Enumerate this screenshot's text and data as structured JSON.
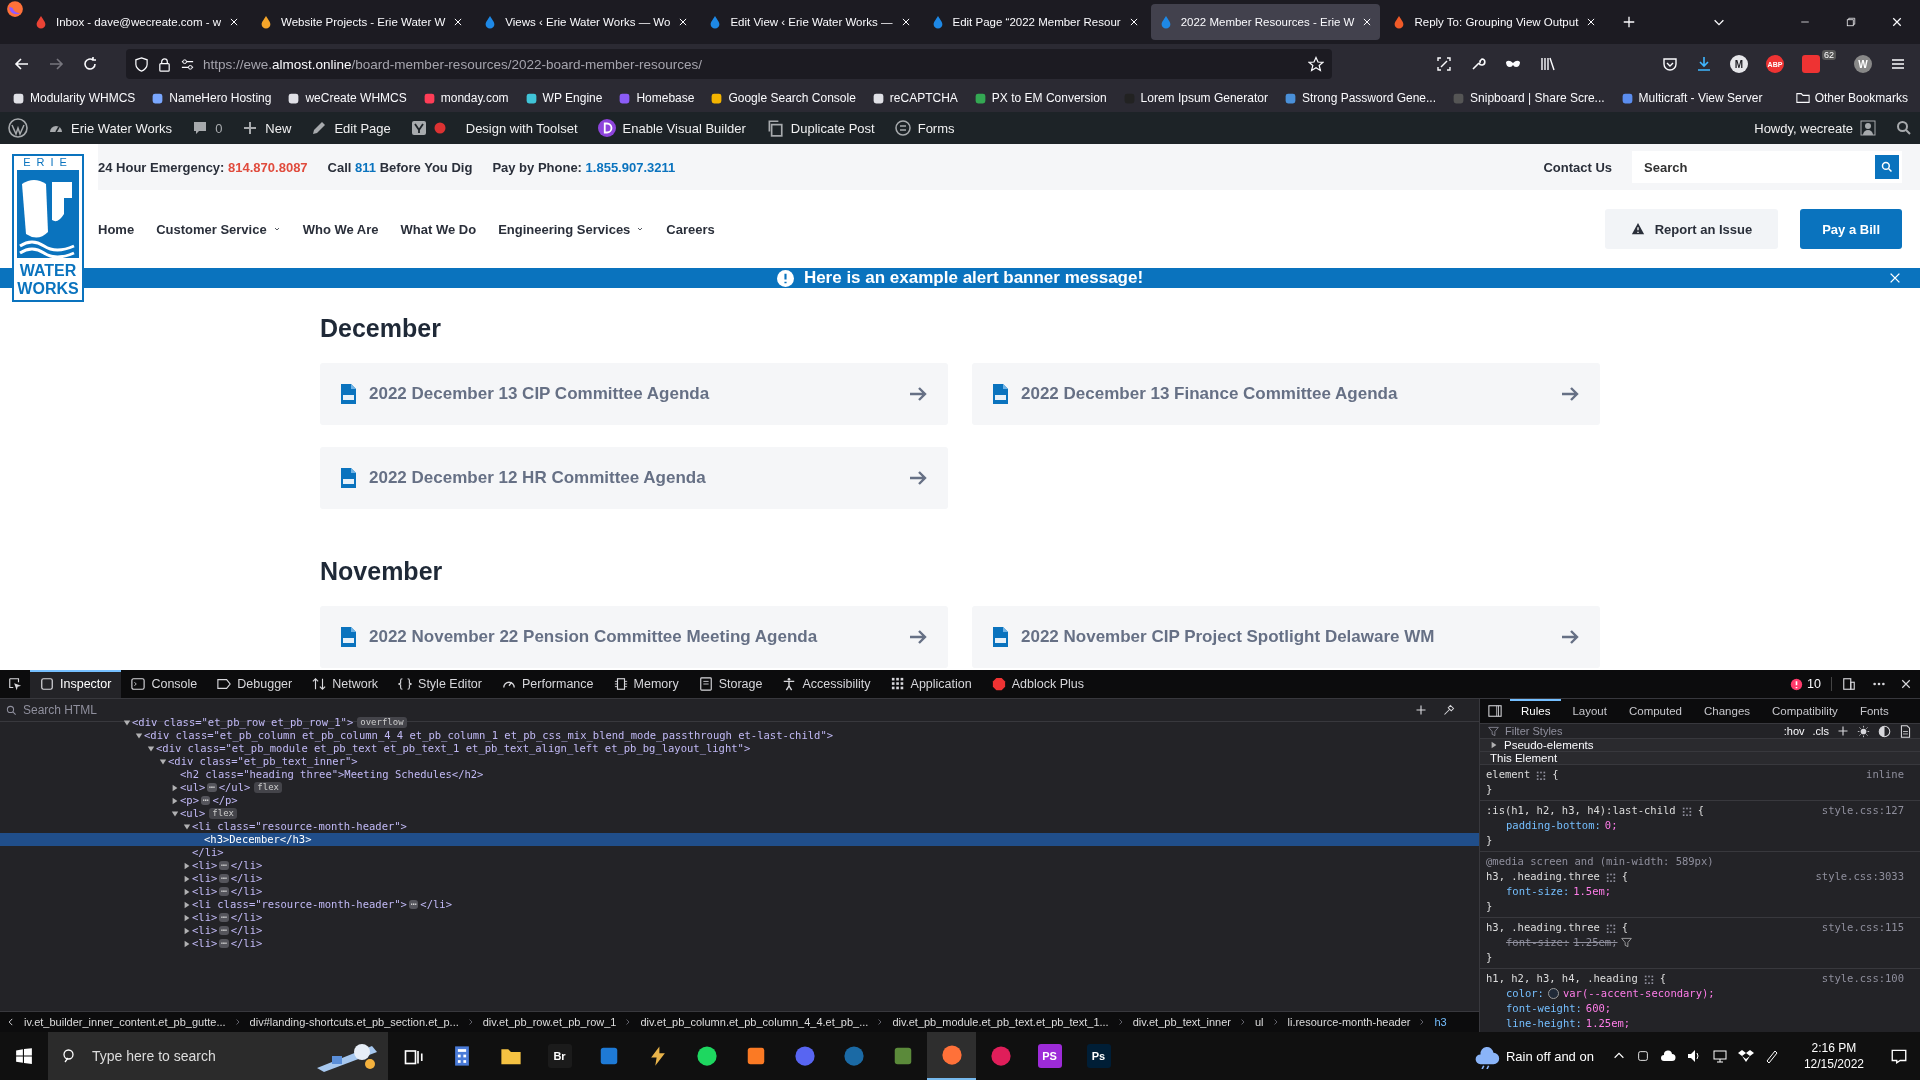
{
  "browser": {
    "tabs": [
      {
        "title": "Inbox - dave@wecreate.com - w",
        "selected": false,
        "color": "#ea4335"
      },
      {
        "title": "Website Projects - Erie Water W",
        "selected": false,
        "color": "#f4a52a"
      },
      {
        "title": "Views ‹ Erie Water Works — Wo",
        "selected": false,
        "color": "#1e88e5"
      },
      {
        "title": "Edit View ‹ Erie Water Works —",
        "selected": false,
        "color": "#1e88e5"
      },
      {
        "title": "Edit Page “2022 Member Resour",
        "selected": false,
        "color": "#1e88e5"
      },
      {
        "title": "2022 Member Resources - Erie W",
        "selected": true,
        "color": "#1e88e5"
      },
      {
        "title": "Reply To: Grouping View Output",
        "selected": false,
        "color": "#f05a28"
      }
    ],
    "url": {
      "start": "https://ewe.",
      "domain": "almost.online",
      "path": "/board-member-resources/2022-board-member-resources/"
    },
    "extension_badge": "62",
    "abp_label": "ABP",
    "profile_letter": "M",
    "account_letter": "W",
    "bookmarks": [
      {
        "label": "Modularity WHMCS",
        "color": "#e0e0e6"
      },
      {
        "label": "NameHero Hosting",
        "color": "#7aa7ff"
      },
      {
        "label": "weCreate WHMCS",
        "color": "#e0e0e6"
      },
      {
        "label": "monday.com",
        "color": "#ff3d57"
      },
      {
        "label": "WP Engine",
        "color": "#40c4d8"
      },
      {
        "label": "Homebase",
        "color": "#8b5cf6"
      },
      {
        "label": "Google Search Console",
        "color": "#f4b400"
      },
      {
        "label": "reCAPTCHA",
        "color": "#e0e0e6"
      },
      {
        "label": "PX to EM Conversion",
        "color": "#34a853"
      },
      {
        "label": "Lorem Ipsum Generator",
        "color": "#222222"
      },
      {
        "label": "Strong Password Gene...",
        "color": "#4a90d9"
      },
      {
        "label": "Snipboard | Share Scre...",
        "color": "#555555"
      },
      {
        "label": "Multicraft - View Server",
        "color": "#5b8def"
      }
    ],
    "other_bookmarks": "Other Bookmarks"
  },
  "admin_bar": {
    "site": "Erie Water Works",
    "comments": "0",
    "items": [
      {
        "kind": "new",
        "label": "New"
      },
      {
        "kind": "edit",
        "label": "Edit Page"
      },
      {
        "kind": "seo"
      },
      {
        "kind": "toolset",
        "label": "Design with Toolset"
      },
      {
        "kind": "builder",
        "label": "Enable Visual Builder"
      },
      {
        "kind": "duplicate",
        "label": "Duplicate Post"
      },
      {
        "kind": "forms",
        "label": "Forms"
      }
    ],
    "greeting": "Howdy, wecreate"
  },
  "site": {
    "logo": {
      "top": "ERIE",
      "middle": "WATER",
      "bottom": "WORKS"
    },
    "contacts": [
      {
        "kind": "emergency",
        "before": "24 Hour Emergency:",
        "value": "814.870.8087"
      },
      {
        "kind": "dig",
        "before": "Call",
        "value": "811",
        "after": "Before You Dig"
      },
      {
        "kind": "phone",
        "before": "Pay by Phone:",
        "value": "1.855.907.3211"
      }
    ],
    "contact_link": "Contact Us",
    "search": {
      "placeholder": "Search"
    },
    "nav": [
      {
        "label": "Home",
        "dropdown": false
      },
      {
        "label": "Customer Service",
        "dropdown": true
      },
      {
        "label": "Who We Are",
        "dropdown": false
      },
      {
        "label": "What We Do",
        "dropdown": false
      },
      {
        "label": "Engineering Services",
        "dropdown": true
      },
      {
        "label": "Careers",
        "dropdown": false
      }
    ],
    "report_button": "Report an Issue",
    "pay_button": "Pay a Bill",
    "alert": "Here is an example alert banner message!",
    "months": [
      {
        "name": "December",
        "documents": [
          "2022 December 13 CIP Committee Agenda",
          "2022 December 13 Finance Committee Agenda",
          "2022 December 12 HR Committee Agenda"
        ]
      },
      {
        "name": "November",
        "documents": [
          "2022 November 22 Pension Committee Meeting Agenda",
          "2022 November CIP Project Spotlight Delaware WM"
        ]
      }
    ]
  },
  "devtools": {
    "tabs": [
      {
        "label": "Inspector",
        "selected": true,
        "kind": "inspector"
      },
      {
        "label": "Console",
        "selected": false,
        "kind": "console"
      },
      {
        "label": "Debugger",
        "selected": false,
        "kind": "debugger"
      },
      {
        "label": "Network",
        "selected": false,
        "kind": "network"
      },
      {
        "label": "Style Editor",
        "selected": false,
        "kind": "style"
      },
      {
        "label": "Performance",
        "selected": false,
        "kind": "performance"
      },
      {
        "label": "Memory",
        "selected": false,
        "kind": "memory"
      },
      {
        "label": "Storage",
        "selected": false,
        "kind": "storage"
      },
      {
        "label": "Accessibility",
        "selected": false,
        "kind": "accessibility"
      },
      {
        "label": "Application",
        "selected": false,
        "kind": "application"
      },
      {
        "label": "Adblock Plus",
        "selected": false,
        "kind": "adblock"
      }
    ],
    "error_count": "10",
    "search": {
      "placeholder": "Search HTML"
    },
    "tree": [
      {
        "text": "<div class=\"et_pb_row et_pb_row_1\">",
        "badge": "overflow",
        "expanded": true,
        "selected": false,
        "children": [
          {
            "text": "<div class=\"et_pb_column et_pb_column_4_4 et_pb_column_1 et_pb_css_mix_blend_mode_passthrough et-last-child\">",
            "expanded": true,
            "selected": false,
            "children": [
              {
                "text": "<div class=\"et_pb_module et_pb_text et_pb_text_1 et_pb_text_align_left et_pb_bg_layout_light\">",
                "expanded": true,
                "selected": false,
                "children": [
                  {
                    "text": "<div class=\"et_pb_text_inner\">",
                    "expanded": true,
                    "selected": false,
                    "children": [
                      {
                        "text": "<h2 class=\"heading three\">Meeting Schedules</h2>",
                        "selected": false
                      },
                      {
                        "text": "<ul>",
                        "inner": "⋯",
                        "close": "</ul>",
                        "badge": "flex",
                        "expanded": false,
                        "selected": false
                      },
                      {
                        "text": "<p>",
                        "inner": "⋯",
                        "close": "</p>",
                        "expanded": false,
                        "selected": false
                      },
                      {
                        "text": "<ul>",
                        "badge": "flex",
                        "expanded": true,
                        "selected": false,
                        "children": [
                          {
                            "text": "<li class=\"resource-month-header\">",
                            "close": "</li>",
                            "expanded": true,
                            "selected": false,
                            "children": [
                              {
                                "text": "<h3>December</h3>",
                                "selected": true
                              }
                            ]
                          },
                          {
                            "text": "<li>",
                            "inner": "⋯",
                            "close": "</li>",
                            "expanded": false,
                            "selected": false
                          },
                          {
                            "text": "<li>",
                            "inner": "⋯",
                            "close": "</li>",
                            "expanded": false,
                            "selected": false
                          },
                          {
                            "text": "<li>",
                            "inner": "⋯",
                            "close": "</li>",
                            "expanded": false,
                            "selected": false
                          },
                          {
                            "text": "<li class=\"resource-month-header\">",
                            "inner": "⋯",
                            "close": "</li>",
                            "expanded": false,
                            "selected": false
                          },
                          {
                            "text": "<li>",
                            "inner": "⋯",
                            "close": "</li>",
                            "expanded": false,
                            "selected": false
                          },
                          {
                            "text": "<li>",
                            "inner": "⋯",
                            "close": "</li>",
                            "expanded": false,
                            "selected": false
                          },
                          {
                            "text": "<li>",
                            "inner": "⋯",
                            "close": "</li>",
                            "expanded": false,
                            "selected": false
                          }
                        ]
                      }
                    ]
                  }
                ]
              }
            ]
          }
        ]
      }
    ],
    "breadcrumbs": [
      {
        "label": "iv.et_builder_inner_content.et_pb_gutte...",
        "selected": false
      },
      {
        "label": "div#landing-shortcuts.et_pb_section.et_p...",
        "selected": false
      },
      {
        "label": "div.et_pb_row.et_pb_row_1",
        "selected": false
      },
      {
        "label": "div.et_pb_column.et_pb_column_4_4.et_pb_...",
        "selected": false
      },
      {
        "label": "div.et_pb_module.et_pb_text.et_pb_text_1...",
        "selected": false
      },
      {
        "label": "div.et_pb_text_inner",
        "selected": false
      },
      {
        "label": "ul",
        "selected": false
      },
      {
        "label": "li.resource-month-header",
        "selected": false
      },
      {
        "label": "h3",
        "selected": true
      }
    ],
    "side_tabs": [
      {
        "label": "Rules",
        "selected": true
      },
      {
        "label": "Layout",
        "selected": false
      },
      {
        "label": "Computed",
        "selected": false
      },
      {
        "label": "Changes",
        "selected": false
      },
      {
        "label": "Compatibility",
        "selected": false
      },
      {
        "label": "Fonts",
        "selected": false
      }
    ],
    "filter": {
      "placeholder": "Filter Styles"
    },
    "hov": ":hov",
    "cls": ".cls",
    "pseudo": "Pseudo-elements",
    "this_element": "This Element",
    "rules": [
      {
        "selector": "element",
        "open": "{",
        "close": "}",
        "source": "inline"
      },
      {
        "selector": ":is(h1, h2, h3, h4):last-child",
        "open": "{",
        "close": "}",
        "source": "style.css:127",
        "decls": [
          {
            "prop": "padding-bottom:",
            "value": "0;",
            "overridden": false
          }
        ]
      },
      {
        "media": "@media screen and (min-width: 589px)",
        "selector": "h3, .heading.three",
        "open": "{",
        "close": "}",
        "source": "style.css:3033",
        "decls": [
          {
            "prop": "font-size:",
            "value": "1.5em;",
            "overridden": false
          }
        ]
      },
      {
        "selector": "h3, .heading.three",
        "open": "{",
        "close": "}",
        "source": "style.css:115",
        "decls": [
          {
            "prop": "font-size:",
            "value": "1.25em;",
            "overridden": true
          }
        ]
      },
      {
        "selector": "h1, h2, h3, h4, .heading",
        "open": "{",
        "source": "style.css:100",
        "decls": [
          {
            "prop": "color:",
            "value": "var(--accent-secondary);",
            "overridden": false,
            "swatch": true
          },
          {
            "prop": "font-weight:",
            "value": "600;",
            "overridden": false
          },
          {
            "prop": "line-height:",
            "value": "1.25em;",
            "overridden": false
          }
        ]
      }
    ]
  },
  "taskbar": {
    "search": {
      "placeholder": "Type here to search"
    },
    "apps": [
      {
        "kind": "taskview",
        "color": "#ffffff",
        "active": false
      },
      {
        "kind": "calculator",
        "color": "#4a7bd8",
        "active": false
      },
      {
        "kind": "folder",
        "color": "#f5c242",
        "active": false
      },
      {
        "kind": "letters",
        "label": "Br",
        "color": "#1b1b1b",
        "active": false
      },
      {
        "kind": "square",
        "color": "#1e7ad6",
        "active": false
      },
      {
        "kind": "bolt",
        "color": "#e8b34a",
        "active": false
      },
      {
        "kind": "circle",
        "color": "#1ed760",
        "active": false
      },
      {
        "kind": "square",
        "color": "#fb7a24",
        "active": false
      },
      {
        "kind": "circle",
        "color": "#5865f2",
        "active": false
      },
      {
        "kind": "circle",
        "color": "#1b6aa5",
        "active": false
      },
      {
        "kind": "square",
        "color": "#5b8a3a",
        "active": false
      },
      {
        "kind": "circle",
        "color": "#ff7139",
        "active": true
      },
      {
        "kind": "circle",
        "color": "#e01e5a",
        "active": false
      },
      {
        "kind": "letters",
        "label": "PS",
        "color": "#9d2bd8",
        "active": false
      },
      {
        "kind": "letters",
        "label": "Ps",
        "color": "#001e36",
        "active": false
      }
    ],
    "weather": "Rain off and on",
    "time": "2:16 PM",
    "date": "12/15/2022"
  }
}
